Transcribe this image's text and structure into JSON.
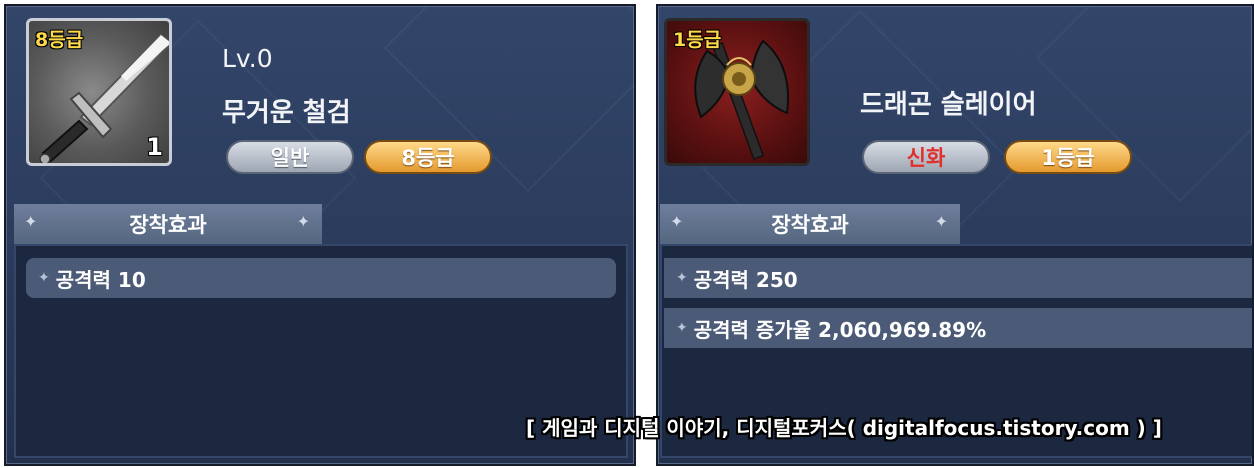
{
  "left_item": {
    "grade_tag": "8등급",
    "count": "1",
    "level": "Lv.0",
    "name": "무거운 철검",
    "rarity": "일반",
    "grade": "8등급",
    "icon": "sword-icon",
    "tab_label": "장착효과",
    "stats": [
      "공격력 10"
    ]
  },
  "right_item": {
    "grade_tag": "1등급",
    "name": "드래곤 슬레이어",
    "rarity": "신화",
    "grade": "1등급",
    "icon": "axe-icon",
    "tab_label": "장착효과",
    "stats": [
      "공격력 250",
      "공격력 증가율 2,060,969.89%"
    ]
  },
  "watermark": "[ 게임과 디지털 이야기, 디지털포커스( digitalfocus.tistory.com ) ]",
  "colors": {
    "panel_bg": "#2c3d5e",
    "grade_pill": "#e49a2e",
    "rarity_pill": "#9ea6b3",
    "myth_text": "#e0302c",
    "grade_tag": "#ffd94a"
  }
}
